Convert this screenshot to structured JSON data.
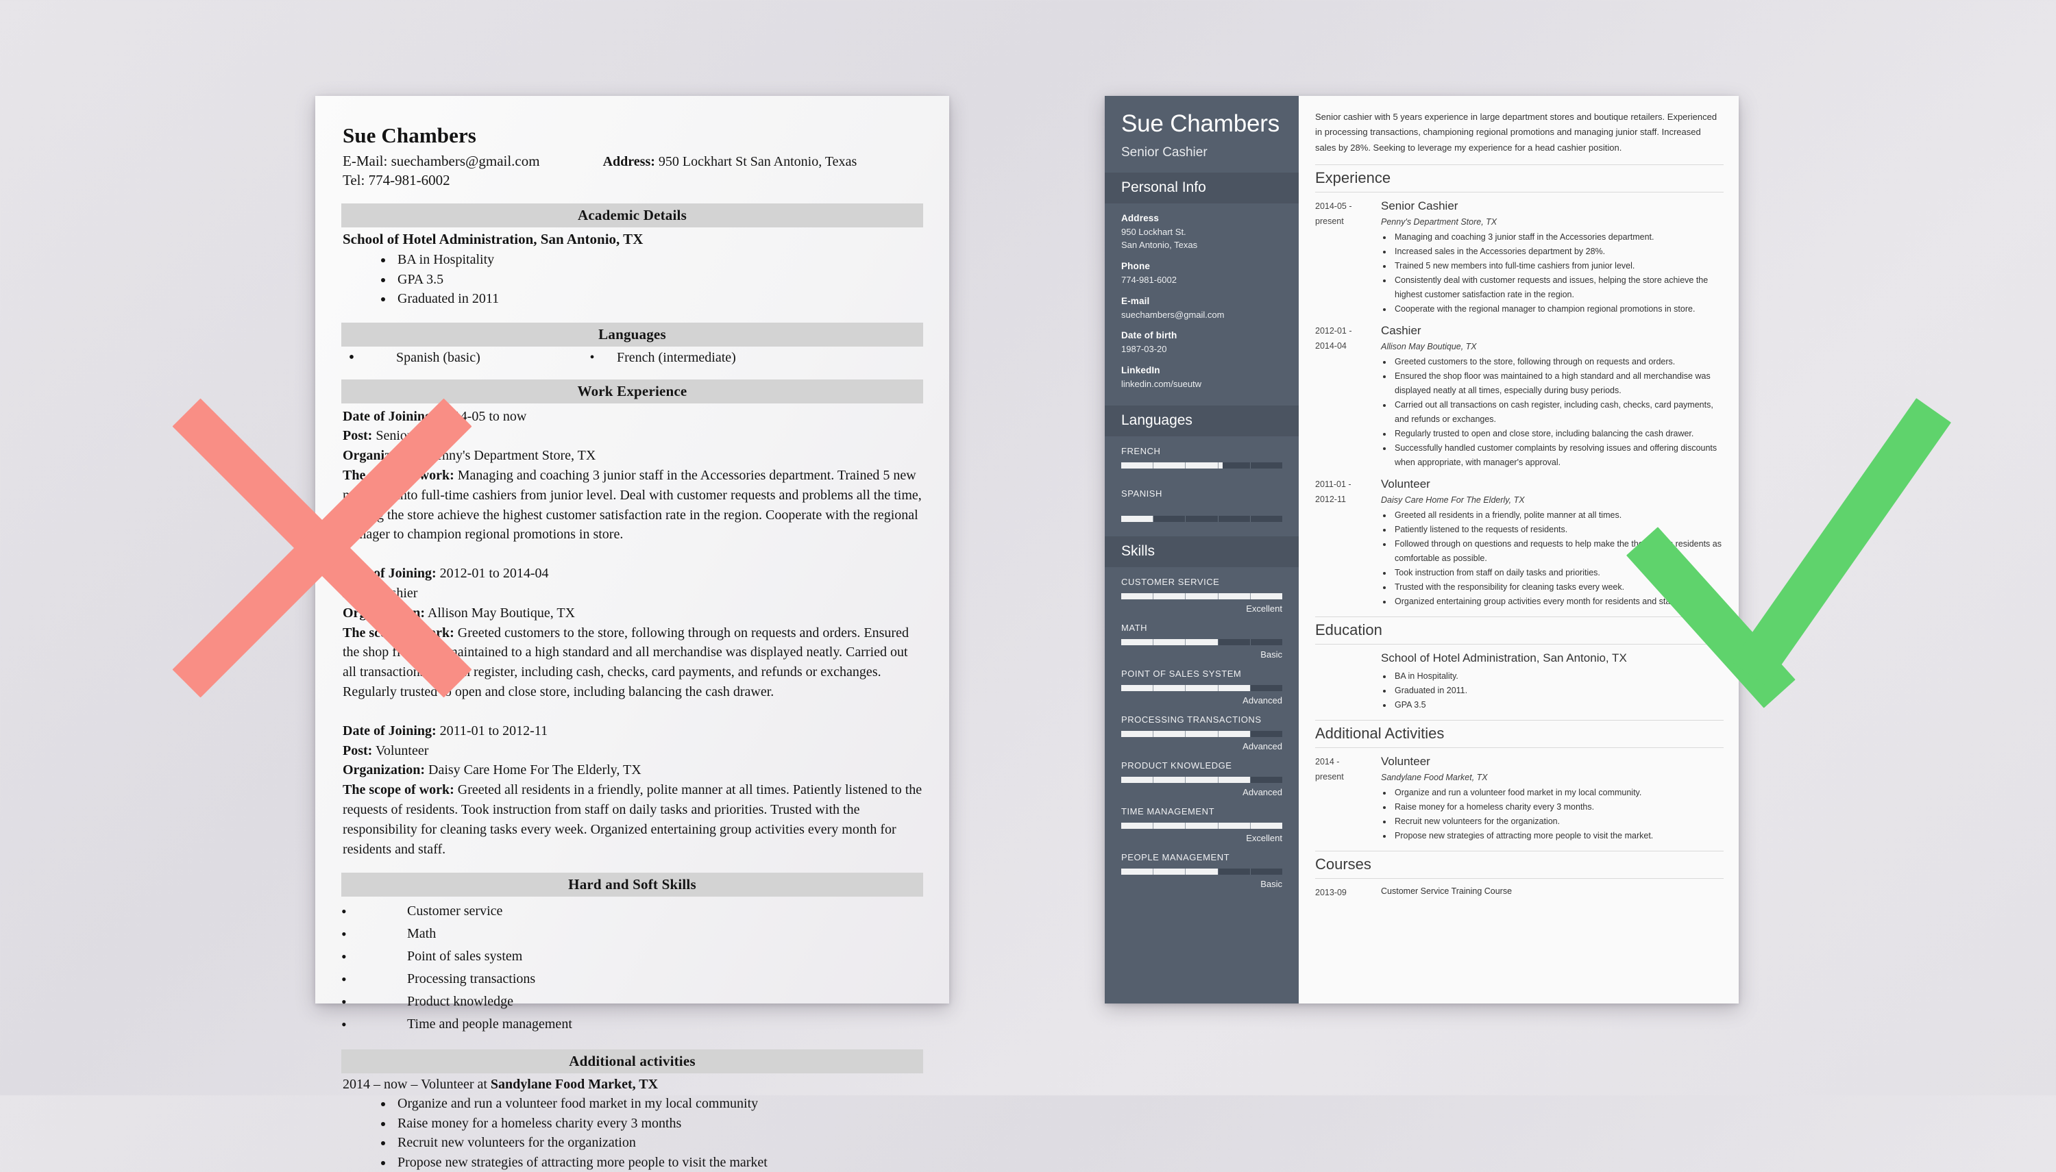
{
  "page": {
    "background_color": "#e5e3e8",
    "bad_mark_color": "#f98e85",
    "good_mark_color": "#5fd36c"
  },
  "bad_resume": {
    "name": "Sue Chambers",
    "email_line": "E-Mail: suechambers@gmail.com",
    "tel_line": "Tel: 774-981-6002",
    "address_label": "Address:",
    "address_value": "950 Lockhart St San Antonio, Texas",
    "sections": {
      "academic": {
        "heading": "Academic Details",
        "school": "School of Hotel Administration, San Antonio, TX",
        "bullets": [
          "BA in Hospitality",
          "GPA 3.5",
          "Graduated in 2011"
        ]
      },
      "languages": {
        "heading": "Languages",
        "left": "Spanish (basic)",
        "right": "French (intermediate)"
      },
      "work": {
        "heading": "Work Experience",
        "entries": [
          {
            "date_label": "Date of Joining:",
            "date_value": "2014-05 to now",
            "post_label": "Post:",
            "post_value": "Senior Cashier",
            "org_label": "Organization:",
            "org_value": "Penny's Department Store, TX",
            "scope_label": "The scope of work:",
            "scope_value": "Managing and coaching 3 junior staff in the Accessories department. Trained 5 new members into full-time cashiers from junior level. Deal with customer requests and problems all the time, helping the store achieve the highest customer satisfaction rate in the region. Cooperate with the regional manager to champion regional promotions in store."
          },
          {
            "date_label": "Date of Joining:",
            "date_value": "2012-01 to 2014-04",
            "post_label": "Post:",
            "post_value": "Cashier",
            "org_label": "Organization:",
            "org_value": "Allison May Boutique, TX",
            "scope_label": "The scope of work:",
            "scope_value": "Greeted customers to the store, following through on requests and orders. Ensured the shop floor was maintained to a high standard and all merchandise was displayed neatly. Carried out all transactions on cash register, including cash, checks, card payments, and refunds or exchanges. Regularly trusted to open and close store, including balancing the cash drawer."
          },
          {
            "date_label": "Date of Joining:",
            "date_value": "2011-01 to 2012-11",
            "post_label": "Post:",
            "post_value": "Volunteer",
            "org_label": "Organization:",
            "org_value": "Daisy Care Home For The Elderly, TX",
            "scope_label": "The scope of work:",
            "scope_value": "Greeted all residents in a friendly, polite manner at all times. Patiently listened to the requests of residents. Took instruction from staff on daily tasks and priorities. Trusted with the responsibility for cleaning tasks every week. Organized entertaining group activities every month for residents and staff."
          }
        ]
      },
      "skills": {
        "heading": "Hard and Soft Skills",
        "items": [
          "Customer service",
          "Math",
          "Point of sales system",
          "Processing transactions",
          "Product knowledge",
          "Time and people management"
        ]
      },
      "activities": {
        "heading": "Additional activities",
        "lead_prefix": "2014 – now – Volunteer at ",
        "lead_org": "Sandylane Food Market, TX",
        "bullets": [
          "Organize and run a volunteer food market in my local community",
          "Raise money for a homeless charity every 3 months",
          "Recruit new volunteers for the organization",
          "Propose new strategies of attracting more people to visit the market"
        ]
      }
    }
  },
  "good_resume": {
    "sidebar": {
      "name": "Sue Chambers",
      "job_title": "Senior Cashier",
      "personal_info_heading": "Personal Info",
      "fields": [
        {
          "label": "Address",
          "value": "950 Lockhart St.\nSan Antonio, Texas"
        },
        {
          "label": "Phone",
          "value": "774-981-6002"
        },
        {
          "label": "E-mail",
          "value": "suechambers@gmail.com"
        },
        {
          "label": "Date of birth",
          "value": "1987-03-20"
        },
        {
          "label": "LinkedIn",
          "value": "linkedin.com/sueutw"
        }
      ],
      "languages_heading": "Languages",
      "languages": [
        {
          "label": "FRENCH",
          "percent": 63,
          "level": ""
        },
        {
          "label": "SPANISH",
          "percent": 20,
          "level": ""
        }
      ],
      "skills_heading": "Skills",
      "skills": [
        {
          "label": "CUSTOMER SERVICE",
          "percent": 100,
          "level": "Excellent"
        },
        {
          "label": "MATH",
          "percent": 60,
          "level": "Basic"
        },
        {
          "label": "POINT OF SALES SYSTEM",
          "percent": 80,
          "level": "Advanced"
        },
        {
          "label": "PROCESSING TRANSACTIONS",
          "percent": 80,
          "level": "Advanced"
        },
        {
          "label": "PRODUCT KNOWLEDGE",
          "percent": 80,
          "level": "Advanced"
        },
        {
          "label": "TIME MANAGEMENT",
          "percent": 100,
          "level": "Excellent"
        },
        {
          "label": "PEOPLE MANAGEMENT",
          "percent": 60,
          "level": "Basic"
        }
      ]
    },
    "main": {
      "summary": "Senior cashier with 5 years experience in large department stores and boutique retailers. Experienced in processing transactions, championing regional promotions and managing junior staff. Increased sales by 28%. Seeking to leverage my experience for a head cashier position.",
      "experience_heading": "Experience",
      "experience": [
        {
          "date": "2014-05 - present",
          "role": "Senior Cashier",
          "org": "Penny's Department Store, TX",
          "bullets": [
            "Managing and coaching 3 junior staff in the Accessories department.",
            "Increased sales in the Accessories department by 28%.",
            "Trained 5 new members into full-time cashiers from junior level.",
            "Consistently deal with customer requests and issues, helping the store achieve the highest customer satisfaction rate in the region.",
            "Cooperate with the regional manager to champion regional promotions in store."
          ]
        },
        {
          "date": "2012-01 - 2014-04",
          "role": "Cashier",
          "org": "Allison May Boutique, TX",
          "bullets": [
            "Greeted customers to the store, following through on requests and orders.",
            "Ensured the shop floor was maintained to a high standard and all merchandise was displayed neatly at all times, especially during busy periods.",
            "Carried out all transactions on cash register, including cash, checks, card payments, and refunds or exchanges.",
            "Regularly trusted to open and close store, including balancing the cash drawer.",
            "Successfully handled customer complaints by resolving issues and offering discounts when appropriate, with manager's approval."
          ]
        },
        {
          "date": "2011-01 - 2012-11",
          "role": "Volunteer",
          "org": "Daisy Care Home For The Elderly, TX",
          "bullets": [
            "Greeted all residents in a friendly, polite manner at all times.",
            "Patiently listened to the requests of residents.",
            "Followed through on questions and requests to help make the the home's residents as comfortable as possible.",
            "Took instruction from staff on daily tasks and priorities.",
            "Trusted with the responsibility for cleaning tasks every week.",
            "Organized entertaining group activities every month for residents and staff."
          ]
        }
      ],
      "education_heading": "Education",
      "education": [
        {
          "date": "",
          "school": "School of Hotel Administration, San Antonio, TX",
          "bullets": [
            "BA in Hospitality.",
            "Graduated in 2011.",
            "GPA 3.5"
          ]
        }
      ],
      "activities_heading": "Additional Activities",
      "activities": [
        {
          "date": "2014 - present",
          "role": "Volunteer",
          "org": "Sandylane Food Market, TX",
          "bullets": [
            "Organize and run a volunteer food market in my local community.",
            "Raise money for a homeless charity every 3 months.",
            "Recruit new volunteers for the organization.",
            "Propose new strategies of attracting more people to visit the market."
          ]
        }
      ],
      "courses_heading": "Courses",
      "courses": [
        {
          "date": "2013-09",
          "name": "Customer Service Training Course"
        }
      ]
    }
  }
}
